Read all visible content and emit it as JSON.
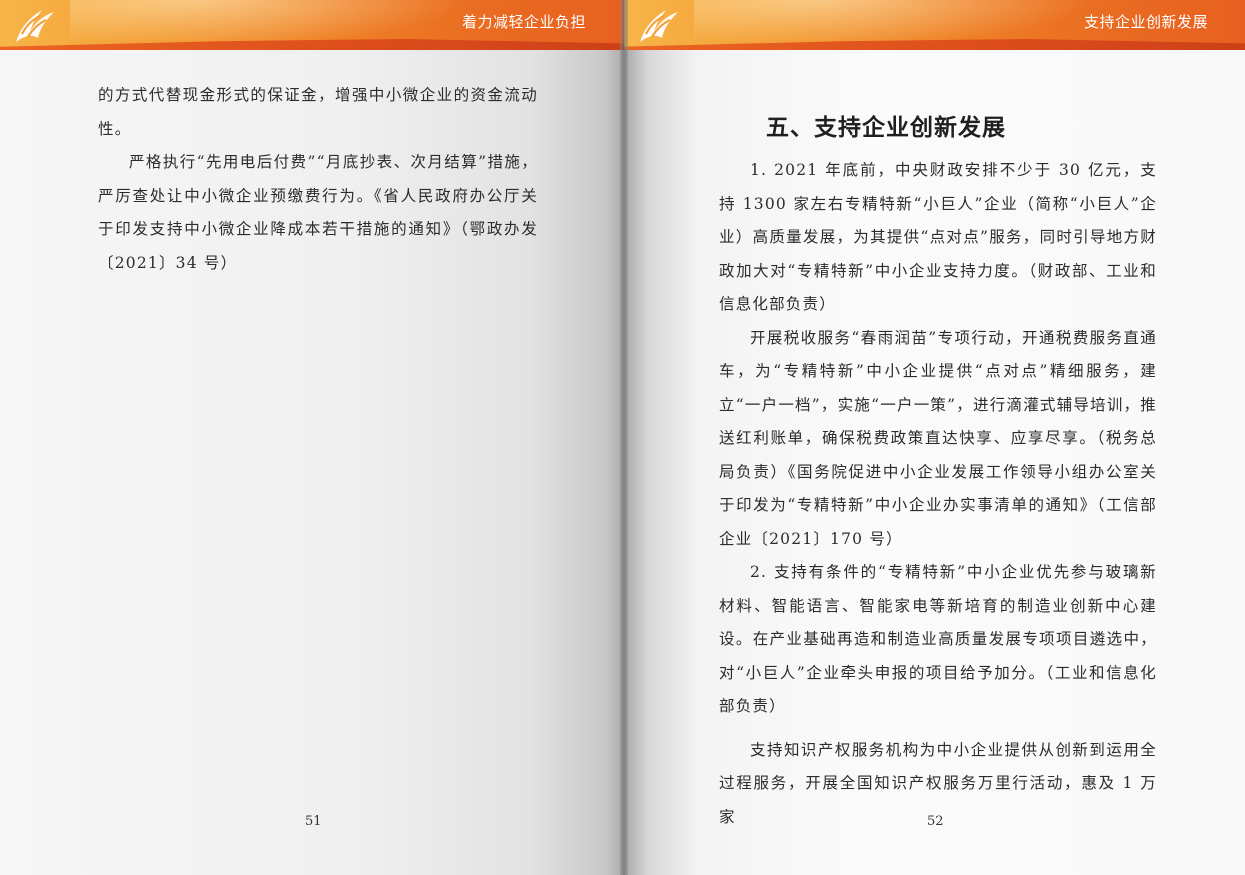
{
  "left_page": {
    "header_title": "着力减轻企业负担",
    "paragraphs": [
      "的方式代替现金形式的保证金，增强中小微企业的资金流动性。",
      "严格执行“先用电后付费”“月底抄表、次月结算”措施，严厉查处让中小微企业预缴费行为。《省人民政府办公厅关于印发支持中小微企业降成本若干措施的通知》（鄂政办发〔2021〕34 号）"
    ],
    "page_number": "51"
  },
  "right_page": {
    "header_title": "支持企业创新发展",
    "section_title": "五、支持企业创新发展",
    "paragraphs": [
      "1. 2021 年底前，中央财政安排不少于 30 亿元，支持 1300 家左右专精特新“小巨人”企业（简称“小巨人”企业）高质量发展，为其提供“点对点”服务，同时引导地方财政加大对“专精特新”中小企业支持力度。（财政部、工业和信息化部负责）",
      "开展税收服务“春雨润苗”专项行动，开通税费服务直通车，为“专精特新”中小企业提供“点对点”精细服务，建立“一户一档”，实施“一户一策”，进行滴灌式辅导培训，推送红利账单，确保税费政策直达快享、应享尽享。（税务总局负责）《国务院促进中小企业发展工作领导小组办公室关于印发为“专精特新”中小企业办实事清单的通知》（工信部企业〔2021〕170 号）",
      "2. 支持有条件的“专精特新”中小企业优先参与玻璃新材料、智能语言、智能家电等新培育的制造业创新中心建设。在产业基础再造和制造业高质量发展专项项目遴选中，对“小巨人”企业牵头申报的项目给予加分。（工业和信息化部负责）",
      "支持知识产权服务机构为中小企业提供从创新到运用全过程服务，开展全国知识产权服务万里行活动，惠及 1 万家"
    ],
    "page_number": "52"
  },
  "logo_icon": "phoenix-logo-icon",
  "colors": {
    "header_orange": "#ee7f26",
    "header_yellow": "#f7b548",
    "header_text": "#ffffff"
  }
}
